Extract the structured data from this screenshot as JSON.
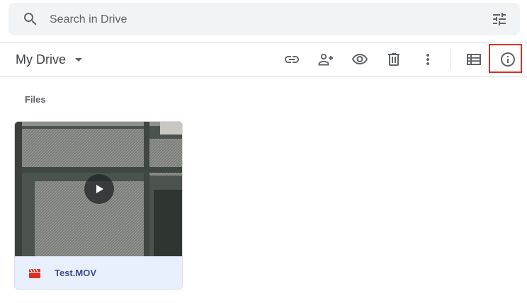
{
  "search": {
    "placeholder": "Search in Drive",
    "value": ""
  },
  "header": {
    "title": "My Drive"
  },
  "toolbar": {
    "items": [
      {
        "icon": "link-icon",
        "label": "Get link"
      },
      {
        "icon": "person-add-icon",
        "label": "Share"
      },
      {
        "icon": "eye-icon",
        "label": "Preview"
      },
      {
        "icon": "trash-icon",
        "label": "Remove"
      },
      {
        "icon": "more-vert-icon",
        "label": "More actions"
      },
      {
        "icon": "list-view-icon",
        "label": "List layout"
      },
      {
        "icon": "info-icon",
        "label": "View details"
      }
    ]
  },
  "files_section": {
    "label": "Files",
    "files": [
      {
        "name": "Test.MOV",
        "type": "video",
        "icon": "video-file-icon"
      }
    ]
  },
  "colors": {
    "search_bg": "#f1f3f4",
    "icon": "#5f6368",
    "highlight": "#d93025",
    "card_footer": "#e8f0fe",
    "file_name": "#3c4b8f",
    "video_icon": "#d93025"
  }
}
